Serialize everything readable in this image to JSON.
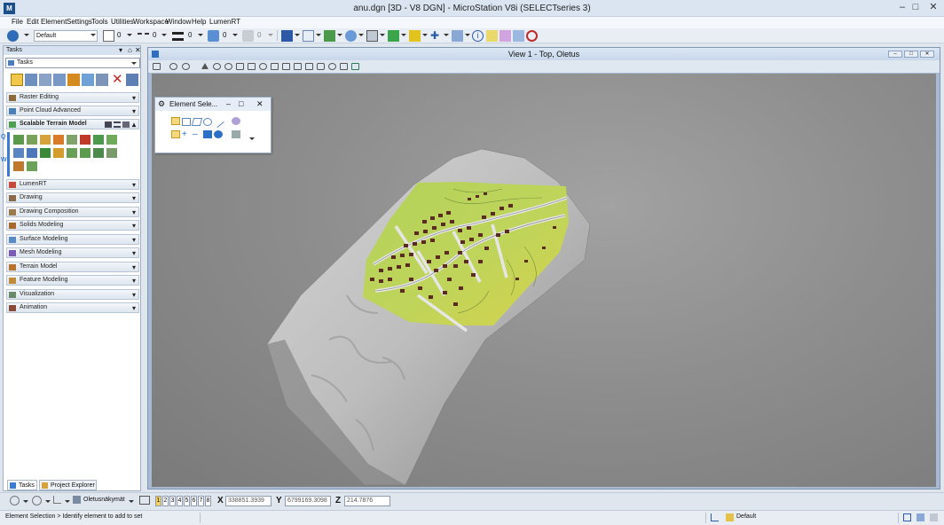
{
  "window": {
    "title": "anu.dgn [3D - V8 DGN] - MicroStation V8i (SELECTseries 3)",
    "app_icon_label": "M"
  },
  "menu": [
    "File",
    "Edit",
    "Element",
    "Settings",
    "Tools",
    "Utilities",
    "Workspace",
    "Window",
    "Help",
    "LumenRT"
  ],
  "toolbar": {
    "level": "Default",
    "color_value": "0",
    "style_value": "0",
    "weight_value": "0",
    "class_value": "0",
    "transparency_value": "0"
  },
  "tasks": {
    "panel_title": "Tasks",
    "combo_value": "Tasks",
    "sections": [
      {
        "label": "Raster Editing",
        "expanded": false
      },
      {
        "label": "Point Cloud Advanced",
        "expanded": false
      },
      {
        "label": "Scalable Terrain Model",
        "expanded": true
      },
      {
        "label": "LumenRT",
        "expanded": false
      },
      {
        "label": "Drawing",
        "expanded": false
      },
      {
        "label": "Drawing Composition",
        "expanded": false
      },
      {
        "label": "Solids Modeling",
        "expanded": false
      },
      {
        "label": "Surface Modeling",
        "expanded": false
      },
      {
        "label": "Mesh Modeling",
        "expanded": false
      },
      {
        "label": "Terrain Model",
        "expanded": false
      },
      {
        "label": "Feature Modeling",
        "expanded": false
      },
      {
        "label": "Visualization",
        "expanded": false
      },
      {
        "label": "Animation",
        "expanded": false
      }
    ],
    "tabs": [
      "Tasks",
      "Project Explorer"
    ]
  },
  "element_selection": {
    "title": "Element Sele..."
  },
  "view": {
    "title": "View 1 - Top, Oletus"
  },
  "coords": {
    "saved_view": "Oletusnäkymät",
    "view_numbers": [
      "1",
      "2",
      "3",
      "4",
      "5",
      "6",
      "7",
      "8"
    ],
    "active_view": 1,
    "x_label": "X",
    "x_value": "338851.3939",
    "y_label": "Y",
    "y_value": "6799169.3098",
    "z_label": "Z",
    "z_value": "214.7876"
  },
  "status": {
    "message": "Element Selection > Identify element to add to set",
    "active_level": "Default"
  },
  "colors": {
    "titlebar": "#dbe5f1",
    "view_frame": "#a7bad2",
    "map_green": "#aacb4b",
    "map_yellow": "#d6d34e",
    "building": "#5b2a22",
    "road": "#e8e8e8",
    "terrain": "#b8b8b8"
  }
}
